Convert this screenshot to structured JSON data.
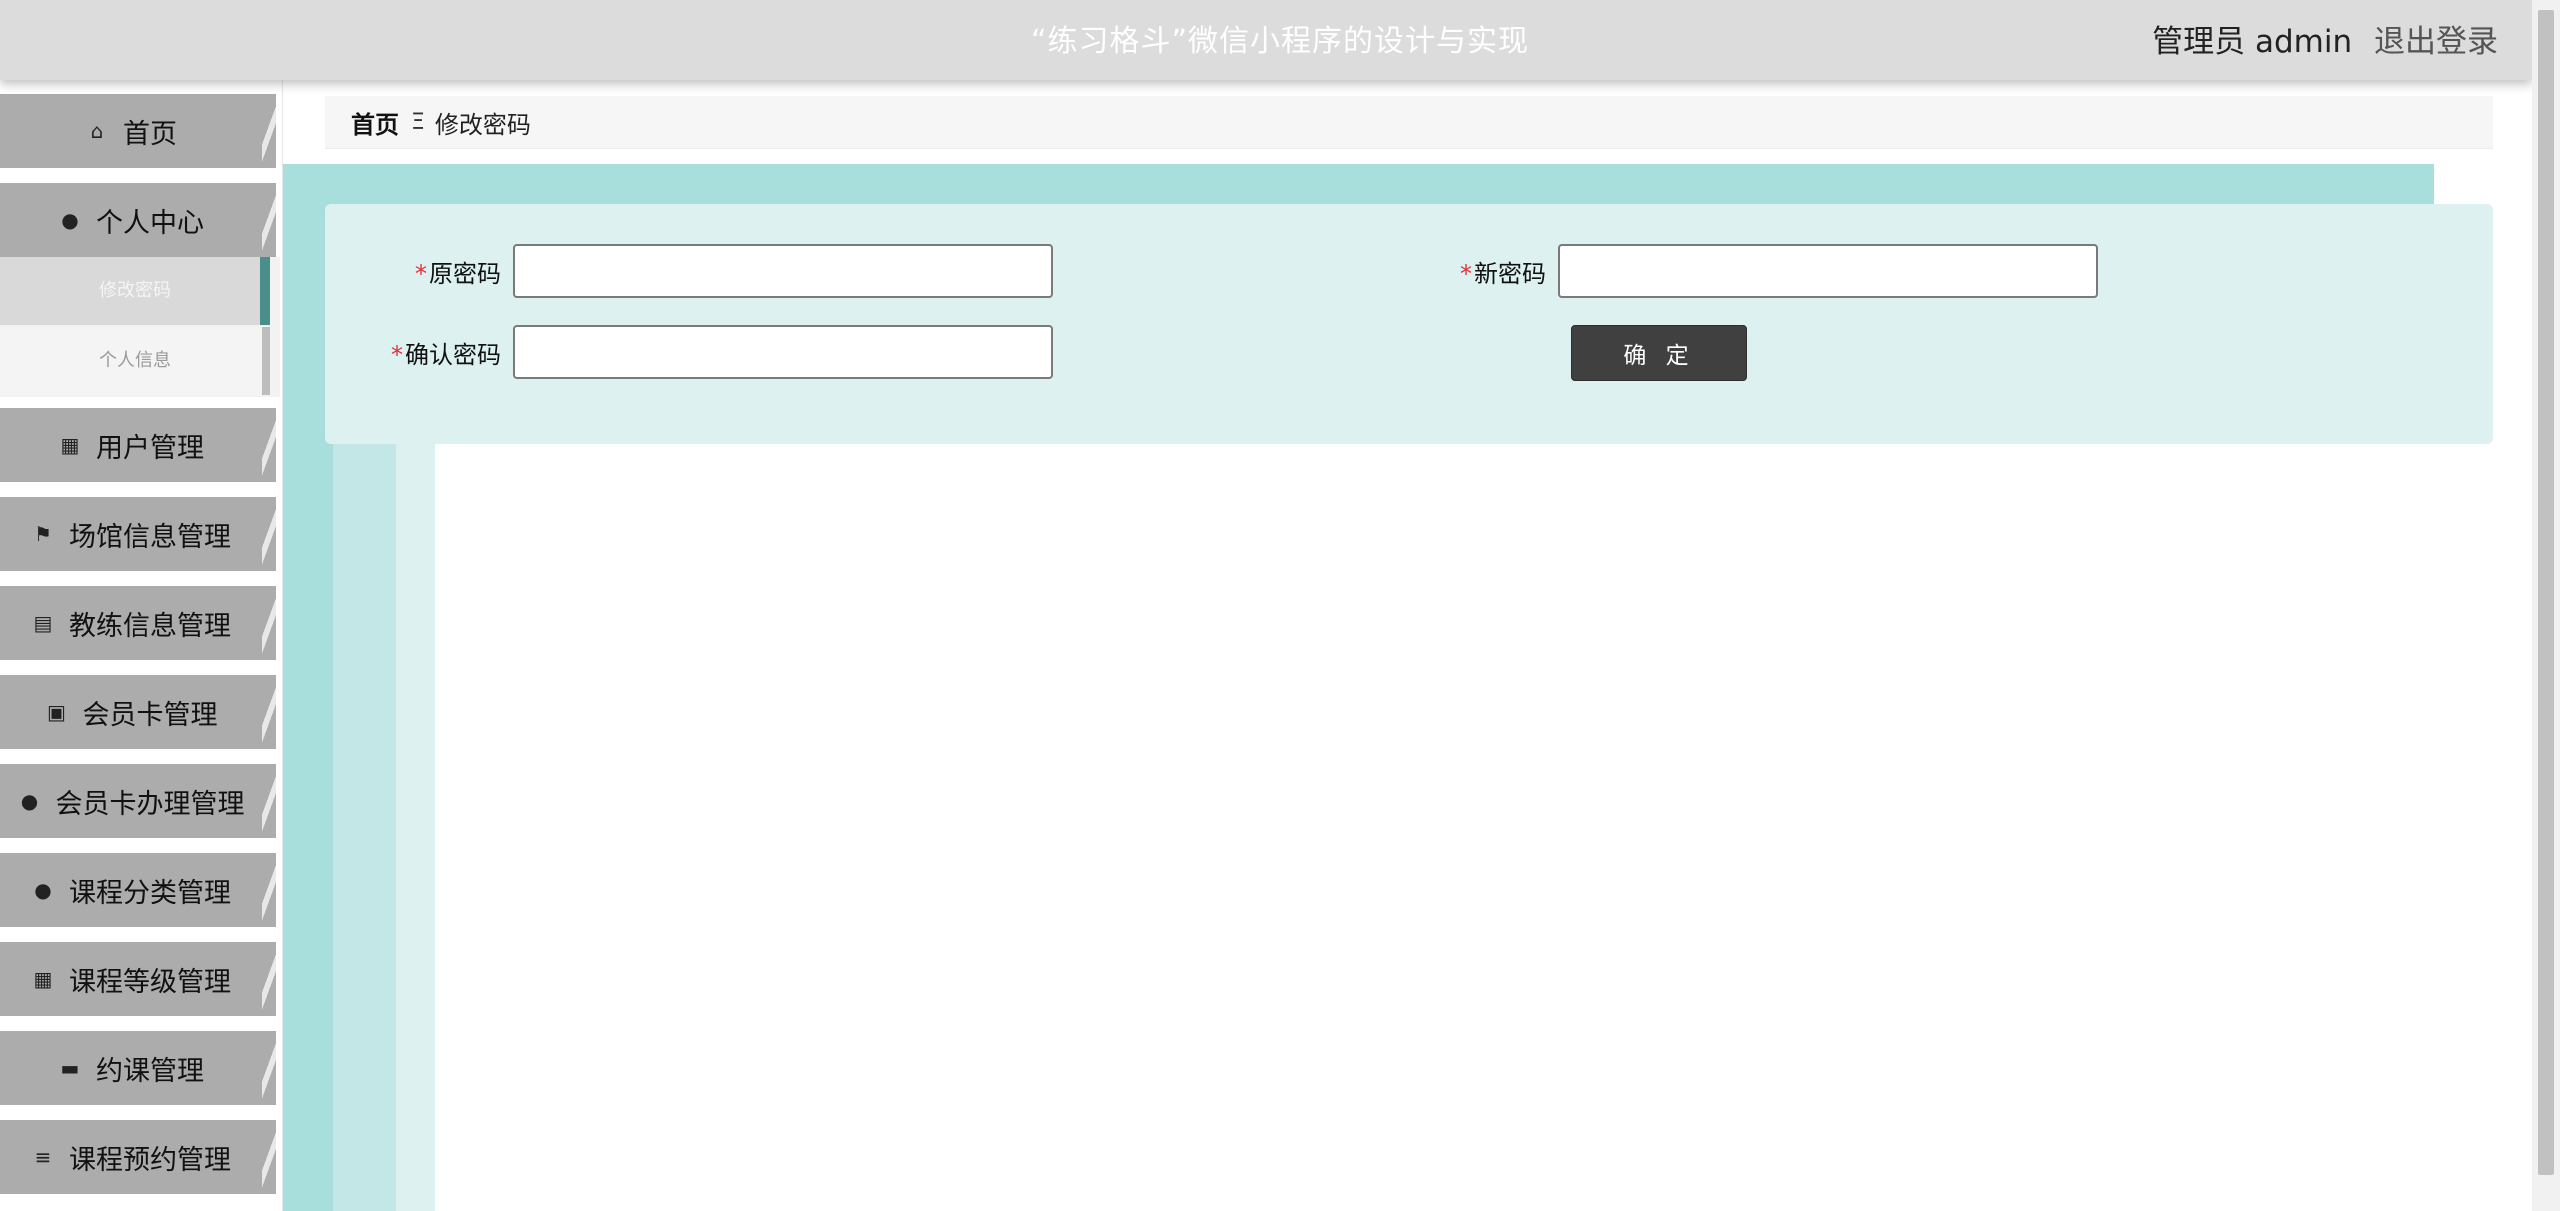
{
  "header": {
    "title": "“练习格斗”微信小程序的设计与实现",
    "user_text": "管理员 admin",
    "logout_label": "退出登录"
  },
  "sidebar": {
    "items": [
      {
        "label": "首页",
        "icon": "home-icon"
      },
      {
        "label": "个人中心",
        "icon": "user-icon"
      },
      {
        "label": "用户管理",
        "icon": "grid-icon"
      },
      {
        "label": "场馆信息管理",
        "icon": "flag-icon"
      },
      {
        "label": "教练信息管理",
        "icon": "chart-icon"
      },
      {
        "label": "会员卡管理",
        "icon": "clipboard-icon"
      },
      {
        "label": "会员卡办理管理",
        "icon": "lightbulb-icon"
      },
      {
        "label": "课程分类管理",
        "icon": "user-icon"
      },
      {
        "label": "课程等级管理",
        "icon": "grid-icon"
      },
      {
        "label": "约课管理",
        "icon": "briefcase-icon"
      },
      {
        "label": "课程预约管理",
        "icon": "list-icon"
      }
    ],
    "submenu": [
      {
        "label": "修改密码",
        "active": true
      },
      {
        "label": "个人信息",
        "active": false
      }
    ]
  },
  "breadcrumb": {
    "home": "首页",
    "separator": "Ξ",
    "current": "修改密码"
  },
  "form": {
    "old_password_label": "原密码",
    "new_password_label": "新密码",
    "confirm_password_label": "确认密码",
    "required_mark": "*",
    "old_password_value": "",
    "new_password_value": "",
    "confirm_password_value": "",
    "submit_label": "确 定"
  },
  "colors": {
    "header_bg": "#dcdcdc",
    "sidebar_item_bg": "#acacac",
    "teal_accent": "#a8dedc",
    "form_bg": "#dcf1f0",
    "button_bg": "#404040",
    "required": "#e0303a"
  }
}
